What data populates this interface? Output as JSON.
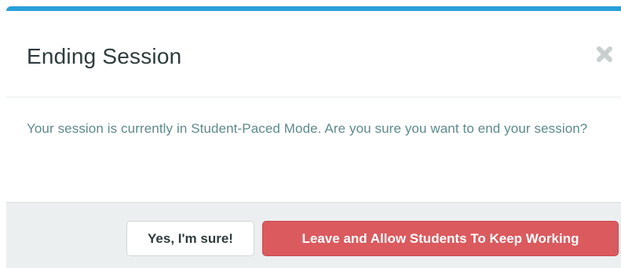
{
  "dialog": {
    "title": "Ending Session",
    "message": "Your session is currently in Student-Paced Mode. Are you sure you want to end your session?",
    "close_icon": "close-icon"
  },
  "buttons": {
    "confirm_label": "Yes, I'm sure!",
    "leave_label": "Leave and Allow Students To Keep Working"
  },
  "colors": {
    "accent_top_bar": "#2a9fdb",
    "danger_button": "#db5a5e",
    "message_text": "#5e8a8c",
    "title_text": "#2f3c3e",
    "footer_bg": "#eceff0"
  }
}
